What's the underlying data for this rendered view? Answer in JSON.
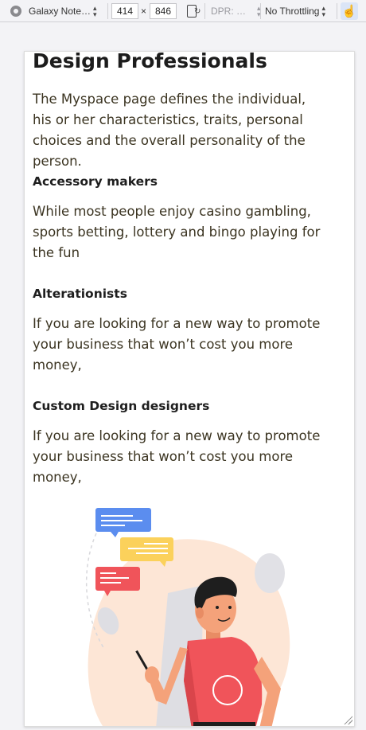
{
  "toolbar": {
    "device": "Galaxy Note…",
    "width": "414",
    "times": "×",
    "height": "846",
    "dpr": "DPR: …",
    "throttling": "No Throttling"
  },
  "page": {
    "title": "Design Professionals",
    "intro": "The Myspace page defines the individual, his or her characteristics, traits, personal choices and the overall personality of the person.",
    "sections": [
      {
        "heading": "Accessory makers",
        "text": "While most people enjoy casino gambling, sports betting, lottery and bingo playing for the fun"
      },
      {
        "heading": "Alterationists",
        "text": "If you are looking for a new way to promote your business that won’t cost you more money,"
      },
      {
        "heading": "Custom Design designers",
        "text": "If you are looking for a new way to promote your business that won’t cost you more money,"
      }
    ]
  },
  "colors": {
    "bubble_blue": "#5b8def",
    "bubble_yellow": "#fbd15b",
    "bubble_red": "#f0545a",
    "shirt": "#f0545a",
    "blob": "#fde6d6",
    "skin": "#f4a27a"
  }
}
